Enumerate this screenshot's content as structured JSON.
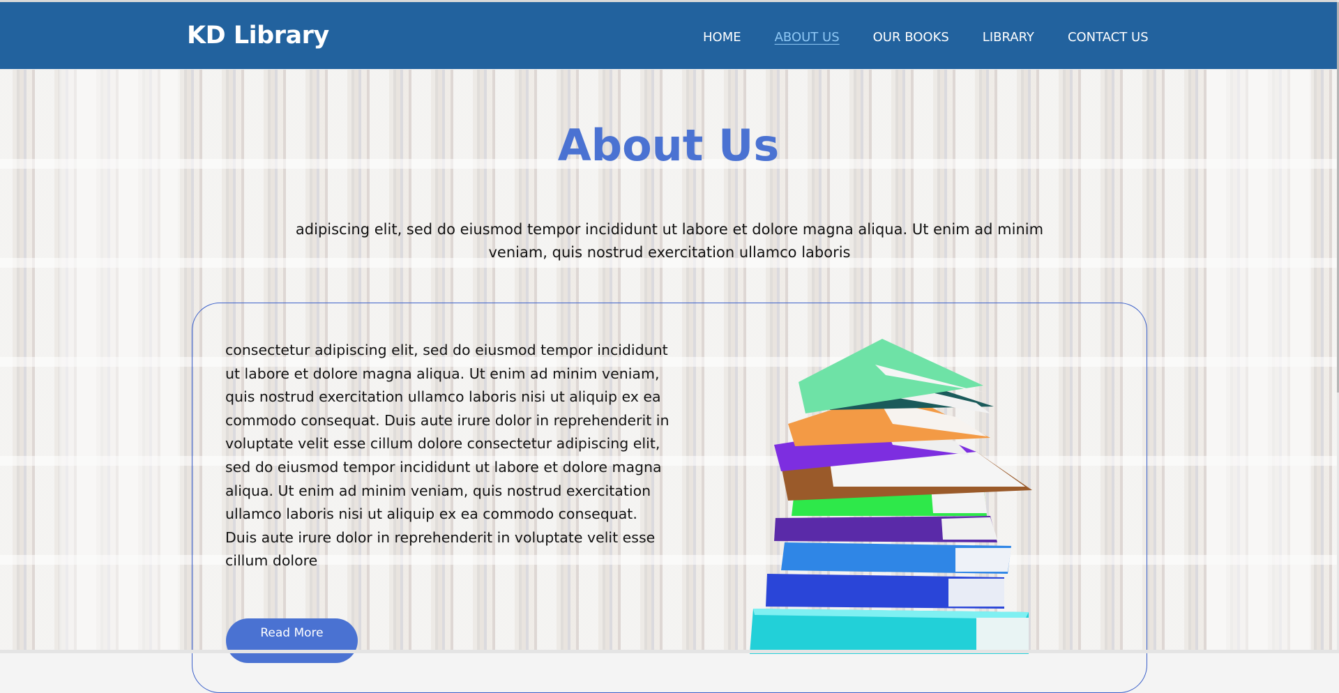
{
  "header": {
    "brand": "KD Library",
    "nav": [
      {
        "label": "HOME",
        "active": false
      },
      {
        "label": "ABOUT US",
        "active": true
      },
      {
        "label": "OUR BOOKS",
        "active": false
      },
      {
        "label": "LIBRARY",
        "active": false
      },
      {
        "label": "CONTACT US",
        "active": false
      }
    ]
  },
  "about": {
    "title": "About Us",
    "intro": "adipiscing elit, sed do eiusmod tempor incididunt ut labore et dolore magna aliqua. Ut enim ad minim veniam, quis nostrud exercitation ullamco laboris",
    "card_text": "consectetur adipiscing elit, sed do eiusmod tempor incididunt ut labore et dolore magna aliqua. Ut enim ad minim veniam, quis nostrud exercitation ullamco laboris nisi ut aliquip ex ea commodo consequat. Duis aute irure dolor in reprehenderit in voluptate velit esse cillum dolore consectetur adipiscing elit, sed do eiusmod tempor incididunt ut labore et dolore magna aliqua. Ut enim ad minim veniam, quis nostrud exercitation ullamco laboris nisi ut aliquip ex ea commodo consequat. Duis aute irure dolor in reprehenderit in voluptate velit esse cillum dolore",
    "read_more": "Read More"
  },
  "colors": {
    "navbar": "#22629e",
    "accent": "#4a72d2",
    "active_link": "#8fc8f5"
  }
}
